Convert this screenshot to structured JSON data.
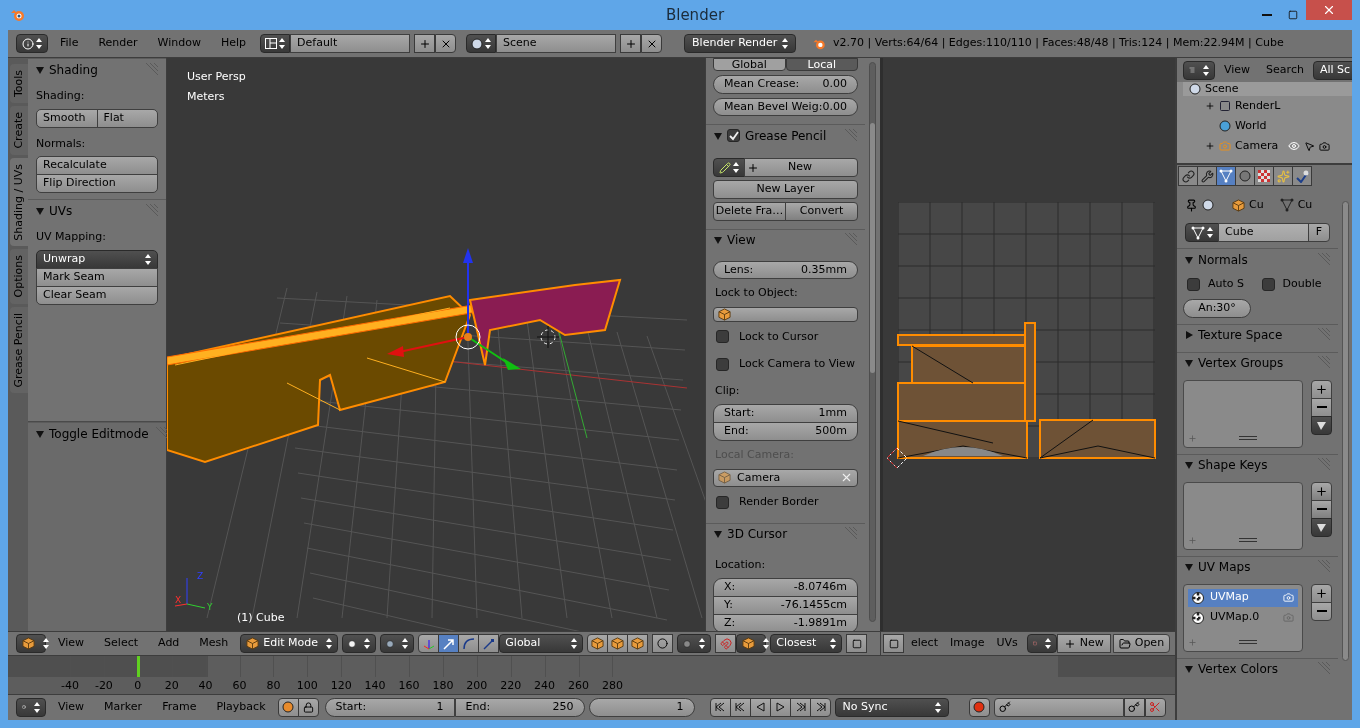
{
  "window": {
    "title": "Blender"
  },
  "info_header": {
    "menus": [
      "File",
      "Render",
      "Window",
      "Help"
    ],
    "layout": "Default",
    "scene": "Scene",
    "engine": "Blender Render",
    "stats": "v2.70 | Verts:64/64 | Edges:110/110 | Faces:48/48 | Tris:124 | Mem:22.94M | Cube"
  },
  "tool_tabs": [
    {
      "label": "Tools",
      "selected": false
    },
    {
      "label": "Create",
      "selected": false
    },
    {
      "label": "Shading / UVs",
      "selected": true
    },
    {
      "label": "Options",
      "selected": false
    },
    {
      "label": "Grease Pencil",
      "selected": false
    }
  ],
  "tool_shelf": [
    {
      "title": "Shading",
      "expanded": true,
      "items": [
        {
          "kind": "label",
          "text": "Shading:"
        },
        {
          "kind": "row",
          "buttons": [
            "Smooth",
            "Flat"
          ]
        },
        {
          "kind": "label",
          "text": "Normals:"
        },
        {
          "kind": "column",
          "buttons": [
            "Recalculate",
            "Flip Direction"
          ]
        }
      ]
    },
    {
      "title": "UVs",
      "expanded": true,
      "items": [
        {
          "kind": "label",
          "text": "UV Mapping:"
        },
        {
          "kind": "menu_stack",
          "dropdown": "Unwrap",
          "buttons": [
            "Mark Seam",
            "Clear Seam"
          ]
        }
      ]
    }
  ],
  "last_operator": {
    "title": "Toggle Editmode",
    "expanded": true
  },
  "viewport": {
    "view_name": "User Persp",
    "units": "Meters",
    "object_label": "(1) Cube",
    "axis_labels": [
      "Z",
      "X",
      "Y"
    ]
  },
  "n_panel": [
    {
      "kind": "toggle_row",
      "options": [
        {
          "label": "Global",
          "selected": false
        },
        {
          "label": "Local",
          "selected": true
        }
      ]
    },
    {
      "kind": "number",
      "label": "Mean Crease:",
      "value": "0.00"
    },
    {
      "kind": "number",
      "label": "Mean Bevel Weig:",
      "value": "0.00"
    },
    {
      "kind": "header",
      "title": "Grease Pencil",
      "expanded": true,
      "checkbox": true,
      "checked": true
    },
    {
      "kind": "new_datablock",
      "label": "New"
    },
    {
      "kind": "button",
      "label": "New Layer"
    },
    {
      "kind": "button_row",
      "buttons": [
        {
          "label": "Delete Fra…",
          "disabled": true
        },
        {
          "label": "Convert",
          "disabled": true
        }
      ]
    },
    {
      "kind": "header",
      "title": "View",
      "expanded": true
    },
    {
      "kind": "number",
      "label": "Lens:",
      "value": "0.35mm"
    },
    {
      "kind": "label",
      "text": "Lock to Object:",
      "disabled": false
    },
    {
      "kind": "object_field",
      "disabled": false
    },
    {
      "kind": "checkbox",
      "label": "Lock to Cursor",
      "checked": false
    },
    {
      "kind": "checkbox",
      "label": "Lock Camera to View",
      "checked": false
    },
    {
      "kind": "label",
      "text": "Clip:",
      "disabled": false
    },
    {
      "kind": "number_group",
      "fields": [
        {
          "label": "Start:",
          "value": "1mm"
        },
        {
          "label": "End:",
          "value": "500m"
        }
      ]
    },
    {
      "kind": "label",
      "text": "Local Camera:",
      "disabled": true
    },
    {
      "kind": "object_field",
      "value": "Camera",
      "disabled": true
    },
    {
      "kind": "checkbox",
      "label": "Render Border",
      "checked": false
    },
    {
      "kind": "header",
      "title": "3D Cursor",
      "expanded": true
    },
    {
      "kind": "label",
      "text": "Location:",
      "disabled": false
    },
    {
      "kind": "number_group",
      "fields": [
        {
          "label": "X:",
          "value": "-8.0746m"
        },
        {
          "label": "Y:",
          "value": "-76.1455cm"
        },
        {
          "label": "Z:",
          "value": "-1.9891m"
        }
      ]
    }
  ],
  "outliner": {
    "menus": [
      "View",
      "Search"
    ],
    "filter": "All Sc",
    "tree": [
      {
        "name": "Scene",
        "kind": "scene",
        "selected": true,
        "children": [
          {
            "name": "RenderL",
            "kind": "render_layers",
            "expandable": true,
            "selected": false
          },
          {
            "name": "World",
            "kind": "world",
            "expandable": false,
            "selected": false
          },
          {
            "name": "Camera",
            "kind": "camera",
            "expandable": true,
            "selected": false
          }
        ]
      }
    ]
  },
  "properties": {
    "tabs": [
      {
        "kind": "constraints",
        "selected": false
      },
      {
        "kind": "modifiers",
        "selected": false
      },
      {
        "kind": "data",
        "selected": true
      },
      {
        "kind": "material",
        "selected": false
      },
      {
        "kind": "texture",
        "selected": false
      },
      {
        "kind": "particles",
        "selected": false
      },
      {
        "kind": "physics",
        "selected": false
      }
    ],
    "breadcrumb": [
      "Cu",
      "Cu"
    ],
    "datablock": {
      "name": "Cube",
      "users": "F"
    },
    "panels": [
      {
        "title": "Normals",
        "expanded": true,
        "items": [
          {
            "kind": "checkboxes",
            "boxes": [
              {
                "label": "Auto S",
                "checked": false
              },
              {
                "label": "Double",
                "checked": false
              }
            ]
          },
          {
            "kind": "pill",
            "label": "An:30°",
            "disabled": true
          }
        ]
      },
      {
        "title": "Texture Space",
        "expanded": false
      },
      {
        "title": "Vertex Groups",
        "expanded": true,
        "items": [
          {
            "kind": "list",
            "buttons_enabled": true,
            "has_menu": true
          }
        ]
      },
      {
        "title": "Shape Keys",
        "expanded": true,
        "items": [
          {
            "kind": "list",
            "buttons_enabled": false,
            "has_menu": true
          }
        ]
      },
      {
        "title": "UV Maps",
        "expanded": true,
        "items": [
          {
            "kind": "list",
            "buttons_enabled": true,
            "has_menu": false,
            "entries": [
              {
                "label": "UVMap",
                "selected": true
              },
              {
                "label": "UVMap.0",
                "selected": false
              }
            ]
          }
        ]
      },
      {
        "title": "Vertex Colors",
        "expanded": true
      }
    ]
  },
  "view3d_header": {
    "menus": [
      "View",
      "Select",
      "Add",
      "Mesh"
    ],
    "mode": "Edit Mode",
    "manipulators": [
      {
        "kind": "axes",
        "selected": false
      },
      {
        "kind": "translate",
        "selected": true
      },
      {
        "kind": "rotate",
        "selected": false
      },
      {
        "kind": "scale",
        "selected": false
      }
    ],
    "orientation": "Global",
    "snap_target": "Closest"
  },
  "uv_header": {
    "menus": [
      "elect",
      "Image",
      "UVs"
    ],
    "new": "New",
    "open": "Open"
  },
  "timeline": {
    "ticks": [
      {
        "label": "-40",
        "current": false
      },
      {
        "label": "-20",
        "current": false
      },
      {
        "label": "0",
        "current": true
      },
      {
        "label": "20",
        "current": false
      },
      {
        "label": "40",
        "current": false
      },
      {
        "label": "60",
        "current": false
      },
      {
        "label": "80",
        "current": false
      },
      {
        "label": "100",
        "current": false
      },
      {
        "label": "120",
        "current": false
      },
      {
        "label": "140",
        "current": false
      },
      {
        "label": "160",
        "current": false
      },
      {
        "label": "180",
        "current": false
      },
      {
        "label": "200",
        "current": false
      },
      {
        "label": "220",
        "current": false
      },
      {
        "label": "240",
        "current": false
      },
      {
        "label": "260",
        "current": false
      },
      {
        "label": "280",
        "current": false
      }
    ]
  },
  "timeline_header": {
    "menus": [
      "View",
      "Marker",
      "Frame",
      "Playback"
    ],
    "start_label": "Start:",
    "start": "1",
    "end_label": "End:",
    "end": "250",
    "current": "1",
    "sync": "No Sync"
  }
}
